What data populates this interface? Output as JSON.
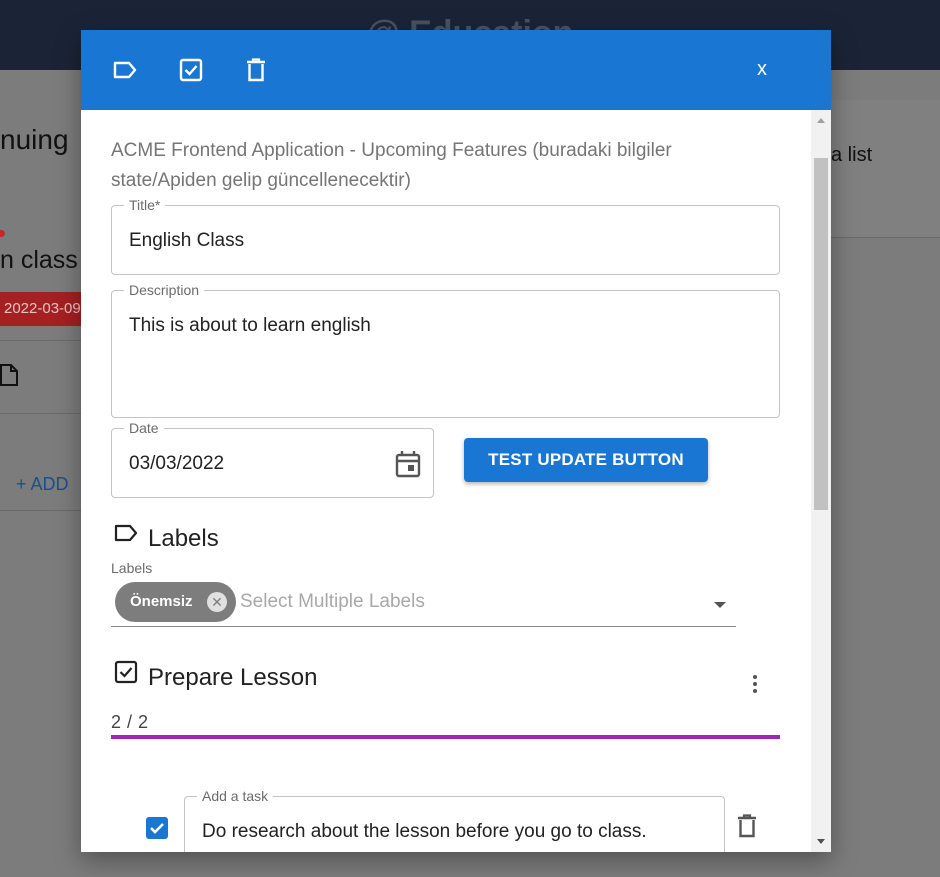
{
  "background": {
    "header_title": "@ Education",
    "card_title_fragment": "nuing",
    "card_subtitle_fragment": "n class",
    "date_badge": "2022-03-09",
    "add_button": "+ ADD",
    "right_text": "a list"
  },
  "toolbar": {
    "icons": [
      "label-icon",
      "checkbox-icon",
      "trash-icon"
    ],
    "close_label": "x"
  },
  "dialog": {
    "intro": "ACME Frontend Application - Upcoming Features (buradaki bilgiler state/Apiden gelip güncellenecektir)",
    "title_field": {
      "label": "Title*",
      "value": "English Class"
    },
    "description_field": {
      "label": "Description",
      "value": "This is about to learn english"
    },
    "date_field": {
      "label": "Date",
      "value": "03/03/2022"
    },
    "update_button": "TEST UPDATE BUTTON",
    "labels_section": {
      "title": "Labels",
      "select_label": "Labels",
      "chips": [
        "Önemsiz"
      ],
      "placeholder": "Select Multiple Labels"
    },
    "checklist": {
      "title": "Prepare Lesson",
      "progress_text": "2 / 2",
      "progress_fraction": 1.0,
      "task_field_label": "Add a task",
      "tasks": [
        {
          "text": "Do research about the lesson before you go to class.",
          "checked": true
        }
      ]
    }
  },
  "colors": {
    "primary": "#1976d2",
    "progress": "#9c27b0",
    "chip": "#7d7d7d",
    "header_dark": "#1b2436"
  }
}
